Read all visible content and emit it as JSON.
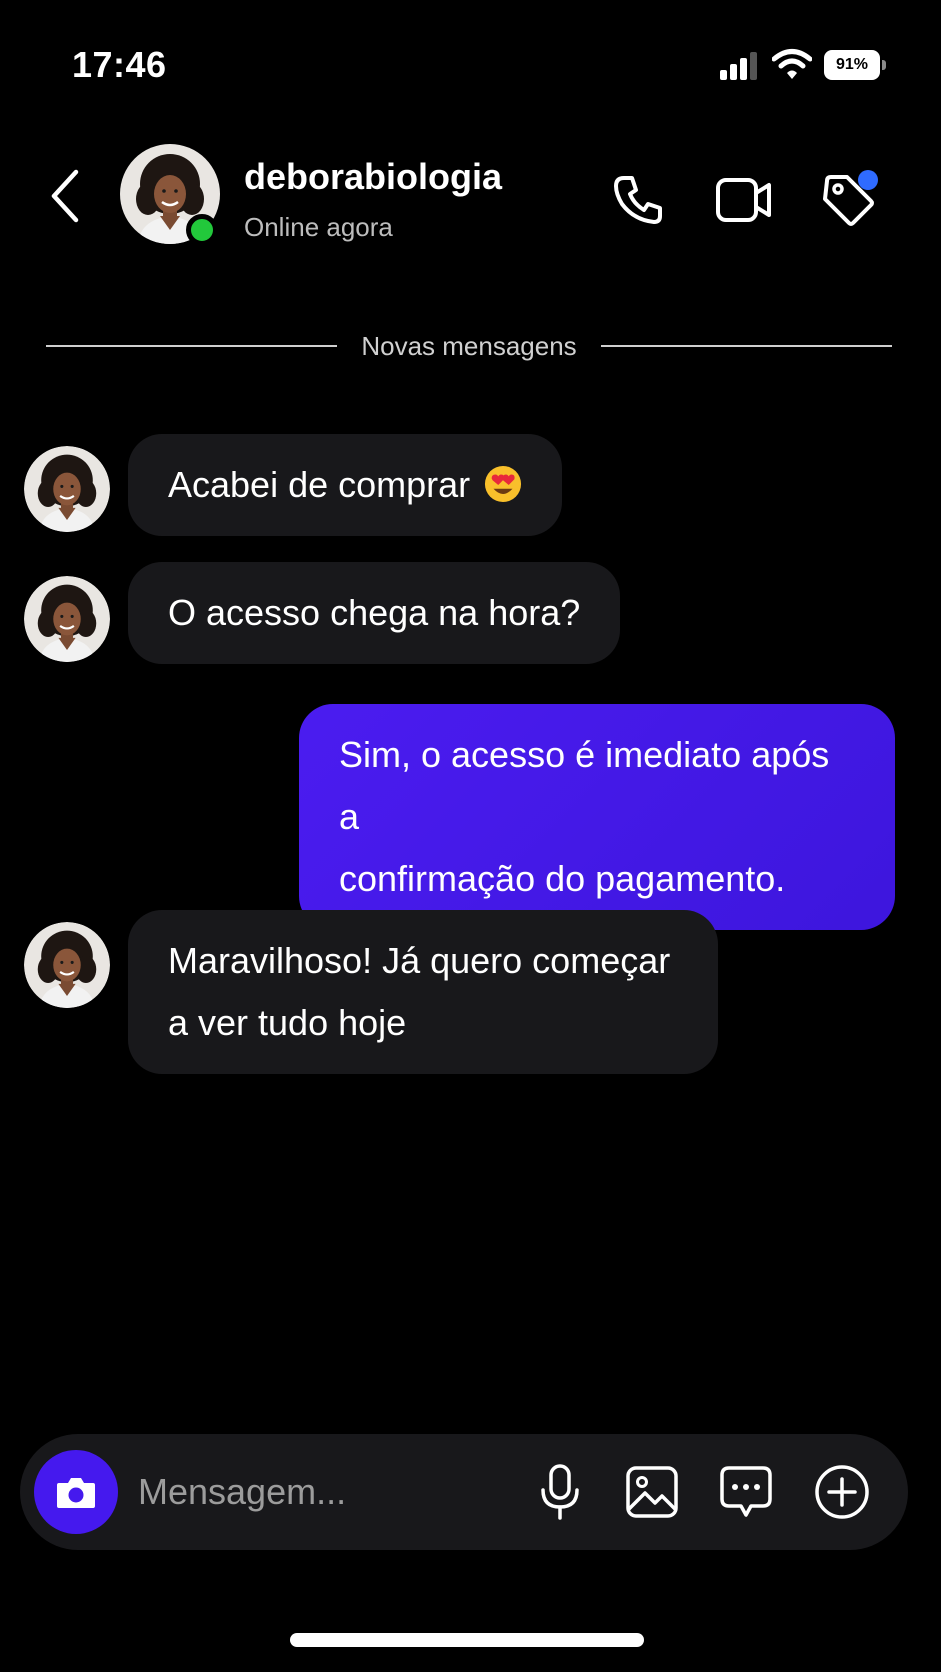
{
  "status_bar": {
    "time": "17:46",
    "battery": "91%",
    "signal_icon": "cellular-signal-icon",
    "wifi_icon": "wifi-icon",
    "battery_icon": "battery-icon"
  },
  "header": {
    "back_icon": "chevron-left-icon",
    "contact_name": "deborabiologia",
    "contact_status": "Online agora",
    "online": true,
    "actions": [
      "phone-icon",
      "video-camera-icon",
      "tag-icon"
    ],
    "tag_has_notification": true
  },
  "divider": {
    "label": "Novas mensagens"
  },
  "messages": [
    {
      "direction": "incoming",
      "text": "Acabei de comprar",
      "emoji": "heart-eyes-emoji"
    },
    {
      "direction": "incoming",
      "text": "O acesso chega na hora?"
    },
    {
      "direction": "outgoing",
      "lines": [
        "Sim, o acesso é imediato após a",
        "confirmação do pagamento."
      ]
    },
    {
      "direction": "incoming",
      "lines": [
        "Maravilhoso! Já quero começar",
        "a ver tudo hoje"
      ]
    }
  ],
  "composer": {
    "placeholder": "Mensagem...",
    "value": "",
    "icons": [
      "camera-icon",
      "microphone-icon",
      "image-icon",
      "chat-bubble-icon",
      "plus-circle-icon"
    ]
  },
  "colors": {
    "background": "#000000",
    "incoming_bubble": "#18181b",
    "outgoing_bubble": "#4b1cf0",
    "online_dot": "#22c83b",
    "notification_dot": "#2f6bff",
    "camera_button": "#4519ee"
  }
}
